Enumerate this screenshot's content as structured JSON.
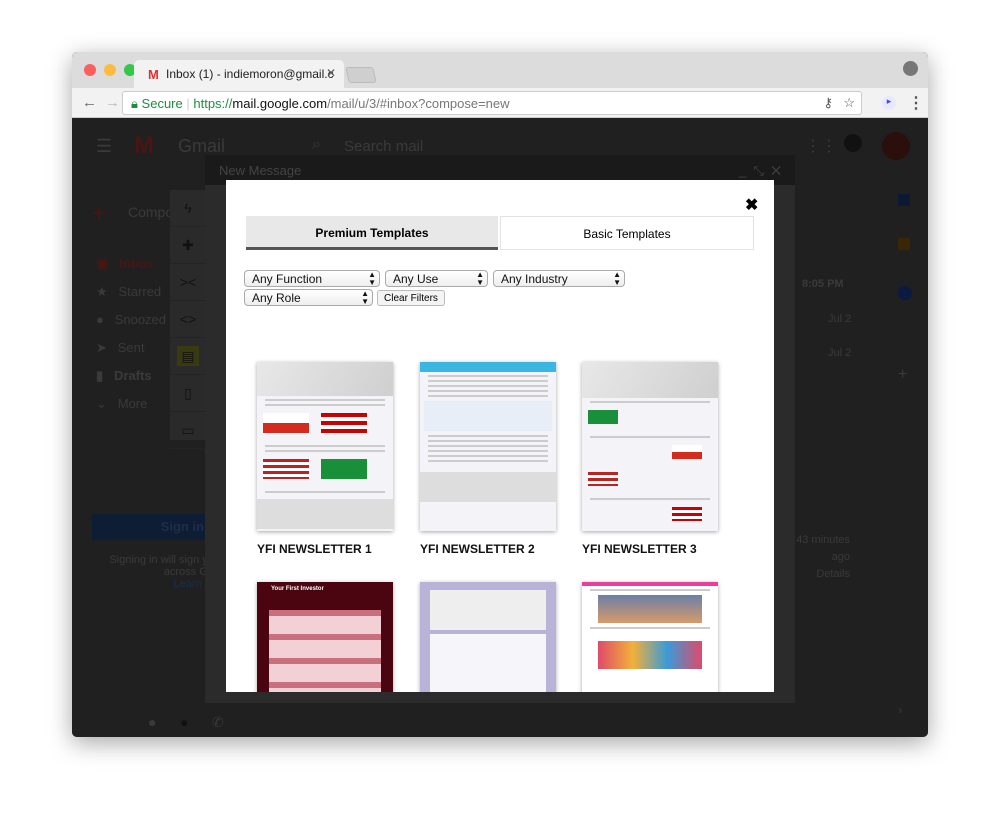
{
  "browser": {
    "tab_title": "Inbox (1) - indiemoron@gmail.c",
    "secure_label": "Secure",
    "url_scheme": "https://",
    "url_host": "mail.google.com",
    "url_path": "/mail/u/3/#inbox?compose=new"
  },
  "gmail": {
    "logo": "Gmail",
    "search_placeholder": "Search mail",
    "compose": "Compose",
    "nav": [
      "Inbox",
      "Starred",
      "Snoozed",
      "Sent",
      "Drafts",
      "More"
    ],
    "signin_button": "Sign in",
    "signin_text": "Signing in will sign you",
    "signin_text2": "across Goo",
    "learn_more": "Learn mo",
    "times": [
      "8:05 PM",
      "Jul 2",
      "Jul 2"
    ],
    "activity": [
      "43 minutes",
      "ago",
      "Details"
    ],
    "compose_title": "New Message"
  },
  "modal": {
    "tabs": [
      {
        "label": "Premium Templates",
        "active": true
      },
      {
        "label": "Basic Templates",
        "active": false
      }
    ],
    "filters": {
      "function": "Any Function",
      "use": "Any Use",
      "industry": "Any Industry",
      "role": "Any Role"
    },
    "clear_filters": "Clear Filters",
    "templates": [
      {
        "name": "YFI NEWSLETTER 1"
      },
      {
        "name": "YFI NEWSLETTER 2"
      },
      {
        "name": "YFI NEWSLETTER 3"
      },
      {
        "name": ""
      },
      {
        "name": ""
      },
      {
        "name": ""
      }
    ],
    "thumb_header": "Your First Investor"
  },
  "colors": {
    "accent": "#1a1a1a",
    "secure": "#1e8e3e",
    "gmail_red": "#d93025"
  }
}
